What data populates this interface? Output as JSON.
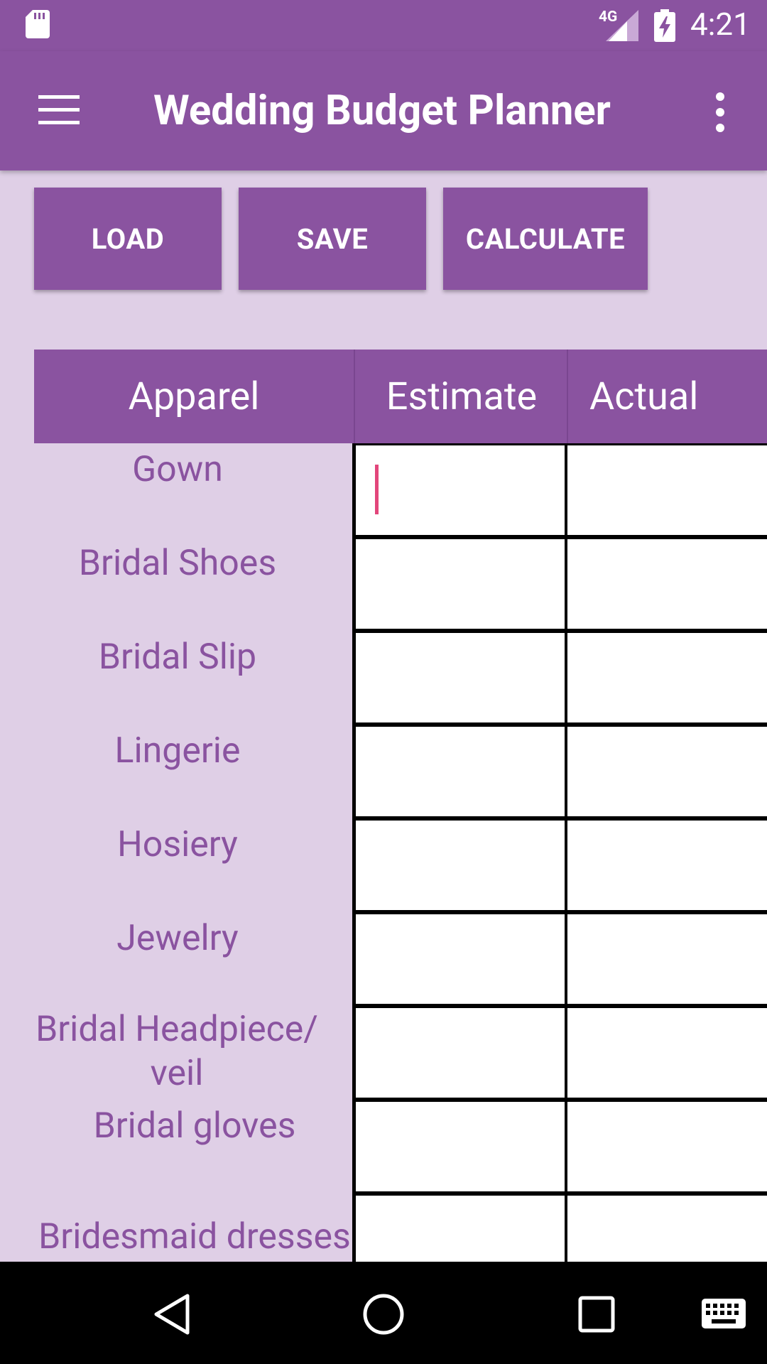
{
  "status_bar": {
    "network": "4G",
    "time": "4:21",
    "icons": [
      "sd-card-icon",
      "signal-icon",
      "battery-charging-icon"
    ]
  },
  "app_bar": {
    "title": "Wedding Budget Planner",
    "menu_icon": "menu-icon",
    "overflow_icon": "more-vert-icon"
  },
  "toolbar": {
    "load_label": "LOAD",
    "save_label": "SAVE",
    "calculate_label": "CALCULATE"
  },
  "table": {
    "headers": [
      "Apparel",
      "Estimate",
      "Actual"
    ],
    "rows": [
      {
        "item": "Gown",
        "estimate": "",
        "actual": ""
      },
      {
        "item": "Bridal Shoes",
        "estimate": "",
        "actual": ""
      },
      {
        "item": "Bridal Slip",
        "estimate": "",
        "actual": ""
      },
      {
        "item": "Lingerie",
        "estimate": "",
        "actual": ""
      },
      {
        "item": "Hosiery",
        "estimate": "",
        "actual": ""
      },
      {
        "item": "Jewelry",
        "estimate": "",
        "actual": ""
      },
      {
        "item": "Bridal Headpiece/ veil",
        "estimate": "",
        "actual": ""
      },
      {
        "item": "Bridal gloves",
        "estimate": "",
        "actual": ""
      },
      {
        "item": "Bridesmaid dresses",
        "estimate": "",
        "actual": ""
      }
    ]
  },
  "nav_bar": {
    "icons": [
      "back-icon",
      "home-icon",
      "recents-icon",
      "keyboard-icon"
    ]
  },
  "colors": {
    "primary": "#8a53a0",
    "background": "#dfcfe6",
    "cursor": "#e2467b"
  }
}
